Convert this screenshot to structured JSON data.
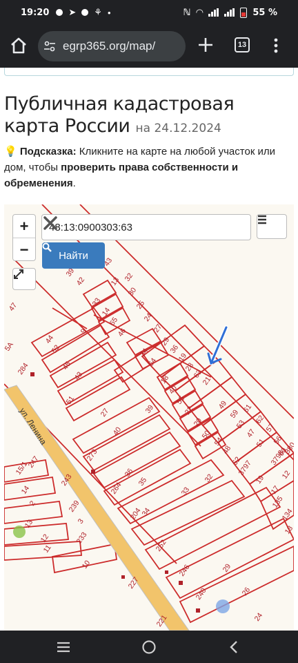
{
  "status_bar": {
    "time": "19:20",
    "battery_percent": "55 %"
  },
  "browser": {
    "url": "egrp365.org/map/",
    "tab_count": "13"
  },
  "page": {
    "title": "Публичная кадастровая карта России",
    "date_prefix": "на",
    "date": "24.12.2024",
    "hint": {
      "icon": "💡",
      "label": "Подсказка:",
      "text_1": "Кликните на карте на любой участок или дом, чтобы",
      "bold": "проверить права собственности и обременения",
      "text_2": "."
    }
  },
  "map": {
    "zoom_in": "+",
    "zoom_out": "−",
    "search_value": "48:13:0900303:63",
    "find_label": "Найти",
    "street_label": "ул. Ленина",
    "parcel_numbers": [
      "39",
      "43",
      "32",
      "13",
      "30",
      "25",
      "24",
      "27",
      "29",
      "36",
      "19",
      "28",
      "63",
      "21",
      "42",
      "33",
      "14",
      "65",
      "46",
      "34",
      "64",
      "44",
      "52",
      "9",
      "45",
      "43",
      "51",
      "18",
      "40",
      "55",
      "22",
      "20",
      "50",
      "27",
      "39",
      "40",
      "36",
      "35",
      "34",
      "33",
      "32",
      "29",
      "26",
      "24",
      "10",
      "11",
      "12",
      "13",
      "14",
      "15/1",
      "2",
      "247",
      "243",
      "239",
      "233",
      "227",
      "252",
      "246",
      "240",
      "221",
      "273",
      "264",
      "204",
      "3",
      "47",
      "5A",
      "284",
      "49",
      "59",
      "53",
      "47",
      "51",
      "61",
      "62",
      "57",
      "56",
      "60",
      "54",
      "48",
      "52",
      "3797",
      "3798",
      "19",
      "12",
      "17",
      "135",
      "134",
      "13",
      "380"
    ],
    "colors": {
      "parcel_line": "#cc2b2b",
      "road_fill": "#f2c46b",
      "road_edge": "#bfbfbf",
      "marker_arrow": "#2f6fd6",
      "find_button": "#3a7bbd"
    }
  }
}
